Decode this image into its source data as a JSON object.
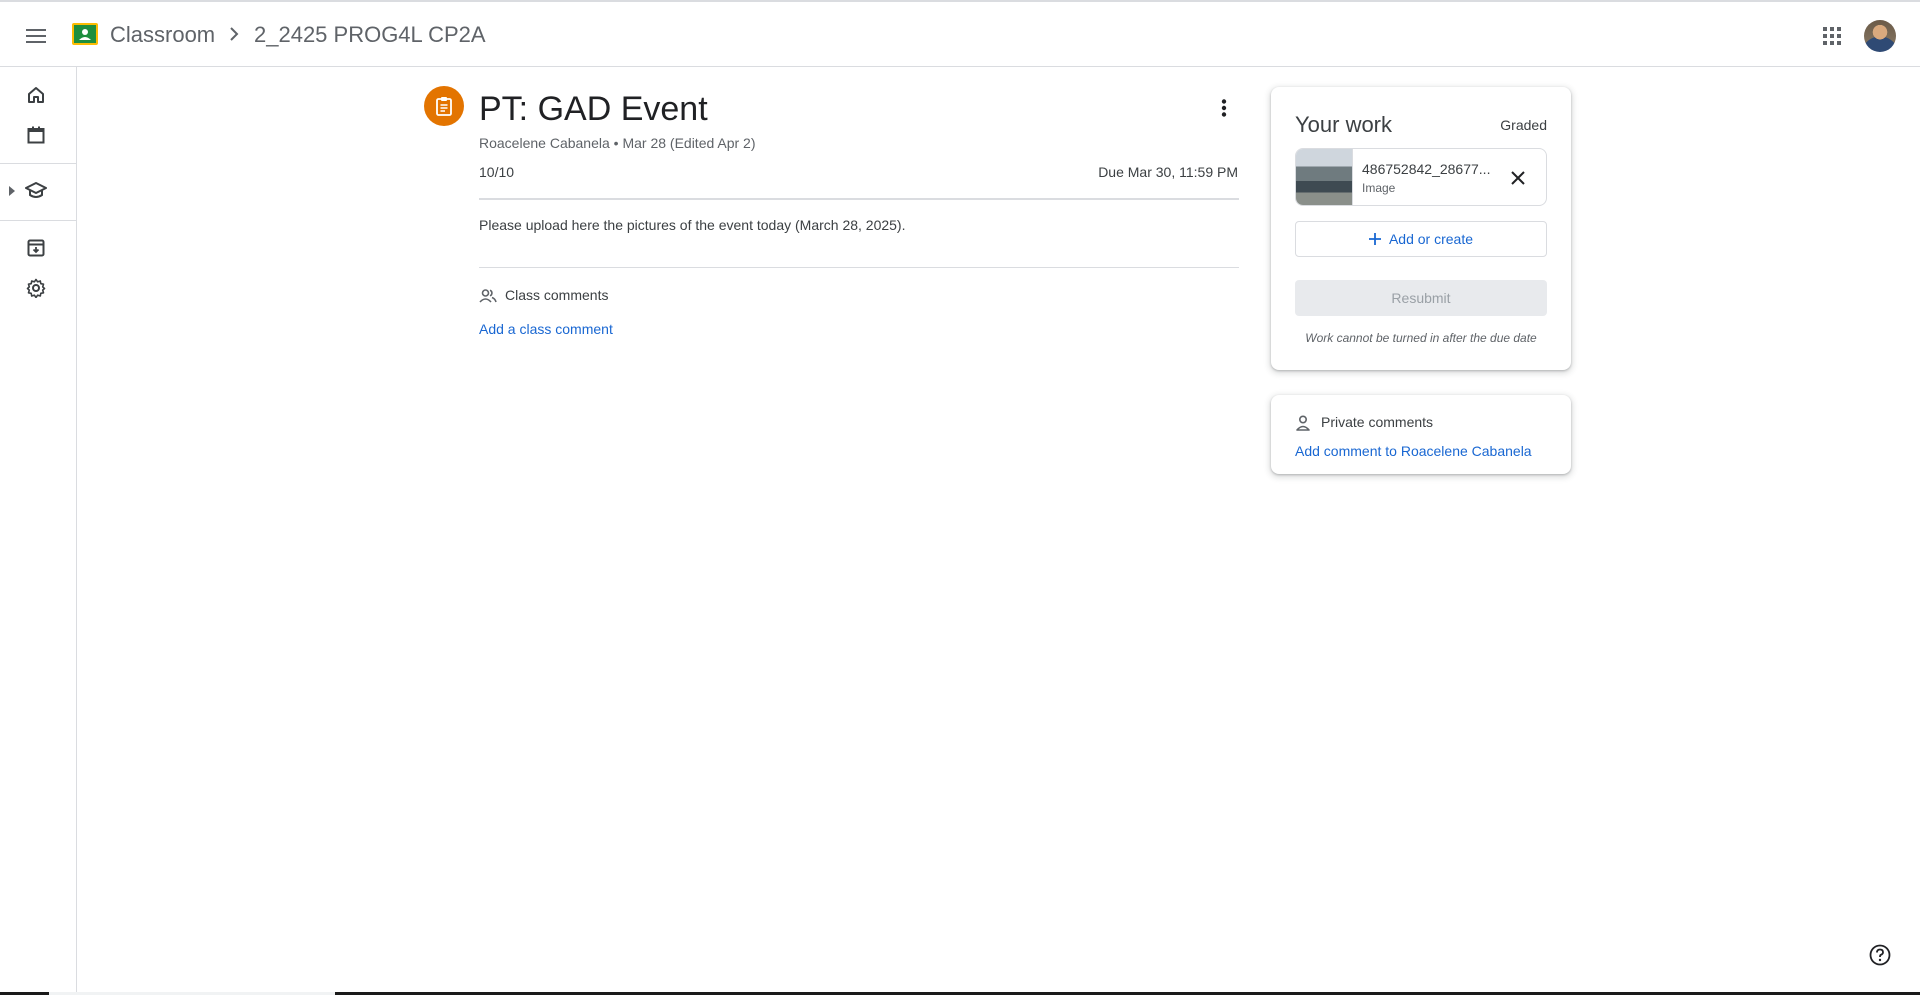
{
  "header": {
    "app_name": "Classroom",
    "class_name": "2_2425 PROG4L CP2A",
    "icons": [
      "menu-icon",
      "classroom-logo",
      "chevron-right-icon",
      "apps-grid-icon",
      "avatar"
    ]
  },
  "sidenav": {
    "items": [
      "home-icon",
      "calendar-icon",
      "enrolled-icon",
      "to-review-icon",
      "settings-icon"
    ]
  },
  "assignment": {
    "title": "PT: GAD Event",
    "meta": "Roacelene Cabanela • Mar 28 (Edited Apr 2)",
    "points": "10/10",
    "due": "Due Mar 30, 11:59 PM",
    "description": "Please upload here the pictures of the event today (March 28, 2025).",
    "class_comments_label": "Class comments",
    "add_class_comment": "Add a class comment"
  },
  "your_work": {
    "title": "Your work",
    "status": "Graded",
    "attachment": {
      "name": "486752842_28677...",
      "type": "Image"
    },
    "add_or_create": "Add or create",
    "resubmit": "Resubmit",
    "note": "Work cannot be turned in after the due date"
  },
  "private_comments": {
    "label": "Private comments",
    "add_link": "Add comment to Roacelene Cabanela"
  },
  "colors": {
    "accent_blue": "#1967d2",
    "assignment_orange": "#e37400",
    "classroom_green": "#1e8e3e",
    "classroom_yellow": "#fbbc04"
  }
}
